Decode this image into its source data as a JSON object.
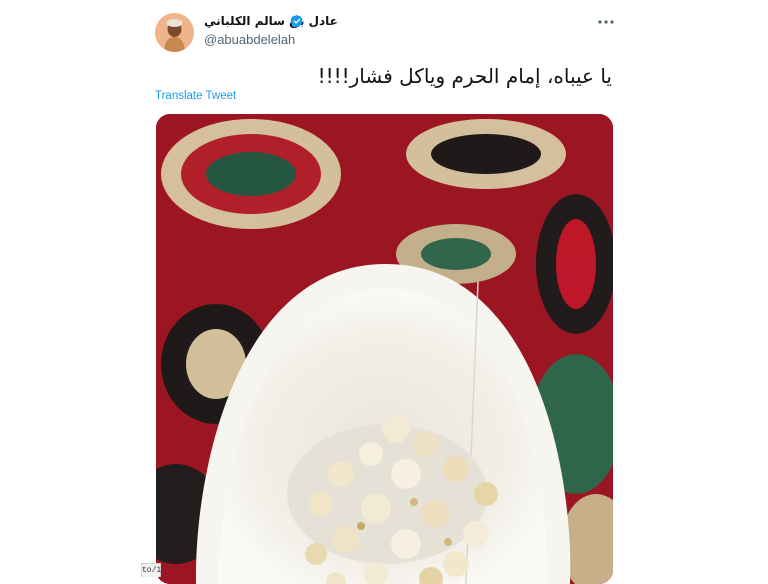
{
  "author": {
    "display_name": "عادل بن سالم الكلباني",
    "handle": "@abuabdelelah",
    "verified": true
  },
  "tweet": {
    "text": "يا عيباه، إمام الحرم وياكل فشار!!!!",
    "translate_label": "Translate Tweet"
  },
  "media": {
    "description_icons": [
      "carpet-pattern",
      "popcorn-cup"
    ]
  },
  "corner_tag": "to/1",
  "colors": {
    "accent": "#1d9bf0",
    "text_primary": "#0f1419",
    "text_secondary": "#536471"
  }
}
